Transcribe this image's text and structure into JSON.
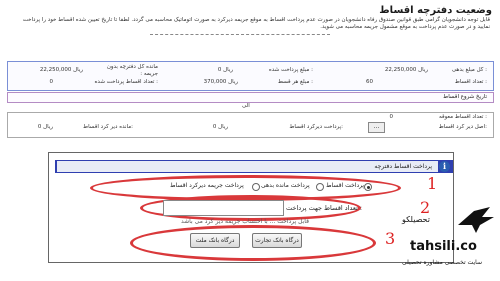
{
  "page": {
    "title": "وضعیت دفترچه اقساط",
    "notice": "قابل توجه دانشجویان گرامی طبق قوانین صندوق رفاه دانشجویان در صورت عدم پرداخت اقساط به موقع جریمه دیرکرد به صورت اتوماتیک محاسبه می گردد. لطفا تا تاریخ تعیین شده اقساط خود را پرداخت نمایید و در صورت عدم پرداخت به موقع مشمول جریمه محاسبه می شوید."
  },
  "summary": {
    "total_debt_label": "کل مبلغ بدهی :",
    "total_debt_value": "22,250,000 ریال",
    "paid_label": "مبلغ پرداخت شده :",
    "paid_value": "0 ریال",
    "remain_label": "مانده کل دفترچه بدون جریمه :",
    "remain_value": "22,250,000 ریال",
    "count_label": "تعداد اقساط :",
    "count_value": "60",
    "installment_label": "مبلغ هر قسط :",
    "installment_value": "370,000 ریال",
    "paid_count_label": "تعداد اقساط پرداخت شده :",
    "paid_count_value": "0"
  },
  "start_date": {
    "label": "تاریخ شروع اقساط",
    "value": "الی"
  },
  "overdue": {
    "count_label": "تعداد اقساط معوقه :",
    "count_value": "0",
    "principal_label": "اصل دیر کرد اقساط:",
    "dots_button": "...",
    "penalty_label": "پرداخت دیرکرد اقساط:",
    "penalty_value": "0 ریال",
    "remain_label": "مانده دیر کرد اقساط:",
    "remain_value": "0 ریال"
  },
  "payment": {
    "header": "پرداخت اقساط دفترچه",
    "options": [
      "پرداخت اقساط",
      "پرداخت مانده بدهی",
      "پرداخت جریمه دیرکرد اقساط"
    ],
    "selected_option": "پرداخت اقساط",
    "input_label": "تعداد اقساط جهت پرداخت :",
    "input_value": "",
    "hint": "قابل پرداخت ... با احتساب جریمه دیر کرد می باشد",
    "button_tejarat": "درگاه بانک تجارت",
    "button_mellat": "درگاه بانک ملت"
  },
  "annotations": [
    "1",
    "2",
    "3"
  ],
  "watermark": {
    "brand": "تحصیلکو",
    "domain": "tahsili.co",
    "tagline": "سایت تخصصی مشاوره تحصیلی"
  }
}
